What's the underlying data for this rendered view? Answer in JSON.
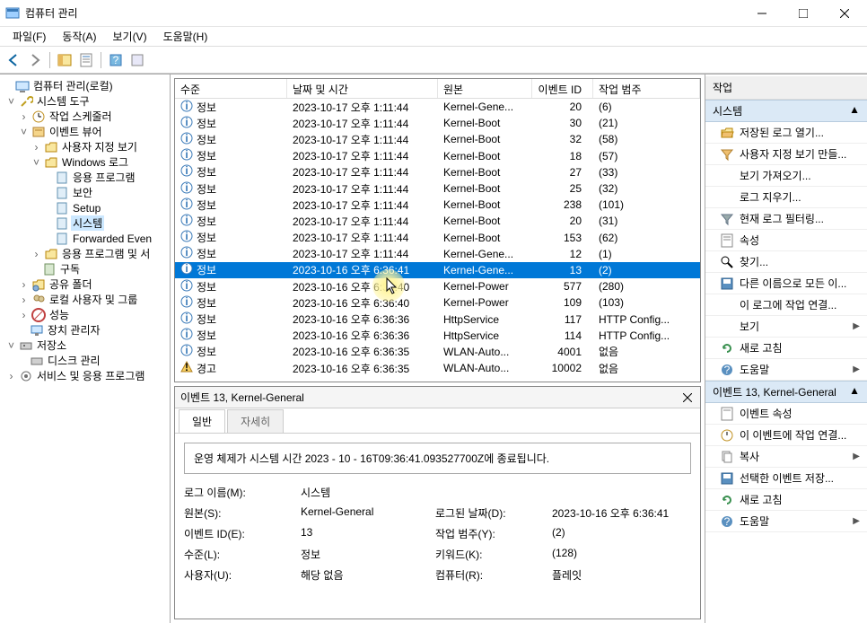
{
  "title": "컴퓨터 관리",
  "menu": {
    "file": "파일(F)",
    "action": "동작(A)",
    "view": "보기(V)",
    "help": "도움말(H)"
  },
  "tree": {
    "root": "컴퓨터 관리(로컬)",
    "sys_tools": "시스템 도구",
    "task_sched": "작업 스케줄러",
    "event_viewer": "이벤트 뷰어",
    "custom_views": "사용자 지정 보기",
    "win_logs": "Windows 로그",
    "app_log": "응용 프로그램",
    "security": "보안",
    "setup": "Setup",
    "system": "시스템",
    "forwarded": "Forwarded Even",
    "app_svc": "응용 프로그램 및 서",
    "subs": "구독",
    "shared": "공유 폴더",
    "users": "로컬 사용자 및 그룹",
    "perf": "성능",
    "devmgr": "장치 관리자",
    "storage": "저장소",
    "diskmgr": "디스크 관리",
    "services": "서비스 및 응용 프로그램"
  },
  "grid": {
    "headers": {
      "level": "수준",
      "datetime": "날짜 및 시간",
      "source": "원본",
      "eventid": "이벤트 ID",
      "category": "작업 범주"
    },
    "rows": [
      {
        "lvl": "정보",
        "dt": "2023-10-17 오후 1:11:44",
        "src": "Kernel-Gene...",
        "id": "20",
        "cat": "(6)"
      },
      {
        "lvl": "정보",
        "dt": "2023-10-17 오후 1:11:44",
        "src": "Kernel-Boot",
        "id": "30",
        "cat": "(21)"
      },
      {
        "lvl": "정보",
        "dt": "2023-10-17 오후 1:11:44",
        "src": "Kernel-Boot",
        "id": "32",
        "cat": "(58)"
      },
      {
        "lvl": "정보",
        "dt": "2023-10-17 오후 1:11:44",
        "src": "Kernel-Boot",
        "id": "18",
        "cat": "(57)"
      },
      {
        "lvl": "정보",
        "dt": "2023-10-17 오후 1:11:44",
        "src": "Kernel-Boot",
        "id": "27",
        "cat": "(33)"
      },
      {
        "lvl": "정보",
        "dt": "2023-10-17 오후 1:11:44",
        "src": "Kernel-Boot",
        "id": "25",
        "cat": "(32)"
      },
      {
        "lvl": "정보",
        "dt": "2023-10-17 오후 1:11:44",
        "src": "Kernel-Boot",
        "id": "238",
        "cat": "(101)"
      },
      {
        "lvl": "정보",
        "dt": "2023-10-17 오후 1:11:44",
        "src": "Kernel-Boot",
        "id": "20",
        "cat": "(31)"
      },
      {
        "lvl": "정보",
        "dt": "2023-10-17 오후 1:11:44",
        "src": "Kernel-Boot",
        "id": "153",
        "cat": "(62)"
      },
      {
        "lvl": "정보",
        "dt": "2023-10-17 오후 1:11:44",
        "src": "Kernel-Gene...",
        "id": "12",
        "cat": "(1)"
      },
      {
        "lvl": "정보",
        "dt": "2023-10-16 오후 6:36:41",
        "src": "Kernel-Gene...",
        "id": "13",
        "cat": "(2)",
        "sel": true
      },
      {
        "lvl": "정보",
        "dt": "2023-10-16 오후 6:36:40",
        "src": "Kernel-Power",
        "id": "577",
        "cat": "(280)"
      },
      {
        "lvl": "정보",
        "dt": "2023-10-16 오후 6:36:40",
        "src": "Kernel-Power",
        "id": "109",
        "cat": "(103)"
      },
      {
        "lvl": "정보",
        "dt": "2023-10-16 오후 6:36:36",
        "src": "HttpService",
        "id": "117",
        "cat": "HTTP Config..."
      },
      {
        "lvl": "정보",
        "dt": "2023-10-16 오후 6:36:36",
        "src": "HttpService",
        "id": "114",
        "cat": "HTTP Config..."
      },
      {
        "lvl": "정보",
        "dt": "2023-10-16 오후 6:36:35",
        "src": "WLAN-Auto...",
        "id": "4001",
        "cat": "없음"
      },
      {
        "lvl": "경고",
        "dt": "2023-10-16 오후 6:36:35",
        "src": "WLAN-Auto...",
        "id": "10002",
        "cat": "없음"
      }
    ]
  },
  "detail": {
    "header": "이벤트 13, Kernel-General",
    "tabs": {
      "general": "일반",
      "detail": "자세히"
    },
    "message": "운영 체제가 시스템 시간 ‎2023‎ - ‎10‎ - ‎16T09:36:41.093527700Z에 종료됩니다.",
    "fields": {
      "logname_l": "로그 이름(M):",
      "logname_v": "시스템",
      "source_l": "원본(S):",
      "source_v": "Kernel-General",
      "logged_l": "로그된 날짜(D):",
      "logged_v": "2023-10-16 오후 6:36:41",
      "eventid_l": "이벤트 ID(E):",
      "eventid_v": "13",
      "category_l": "작업 범주(Y):",
      "category_v": "(2)",
      "level_l": "수준(L):",
      "level_v": "정보",
      "keywords_l": "키워드(K):",
      "keywords_v": "(128)",
      "user_l": "사용자(U):",
      "user_v": "해당 없음",
      "computer_l": "컴퓨터(R):",
      "computer_v": "플레잇"
    }
  },
  "actions": {
    "title": "작업",
    "sec1": "시스템",
    "open_saved": "저장된 로그 열기...",
    "custom_view": "사용자 지정 보기 만들...",
    "import_view": "보기 가져오기...",
    "clear_log": "로그 지우기...",
    "filter": "현재 로그 필터링...",
    "props": "속성",
    "find": "찾기...",
    "saveas": "다른 이름으로 모든 이...",
    "attach": "이 로그에 작업 연결...",
    "view": "보기",
    "refresh": "새로 고침",
    "help": "도움말",
    "sec2": "이벤트 13, Kernel-General",
    "ev_props": "이벤트 속성",
    "ev_attach": "이 이벤트에 작업 연결...",
    "copy": "복사",
    "save_sel": "선택한 이벤트 저장...",
    "ev_refresh": "새로 고침",
    "ev_help": "도움말"
  }
}
